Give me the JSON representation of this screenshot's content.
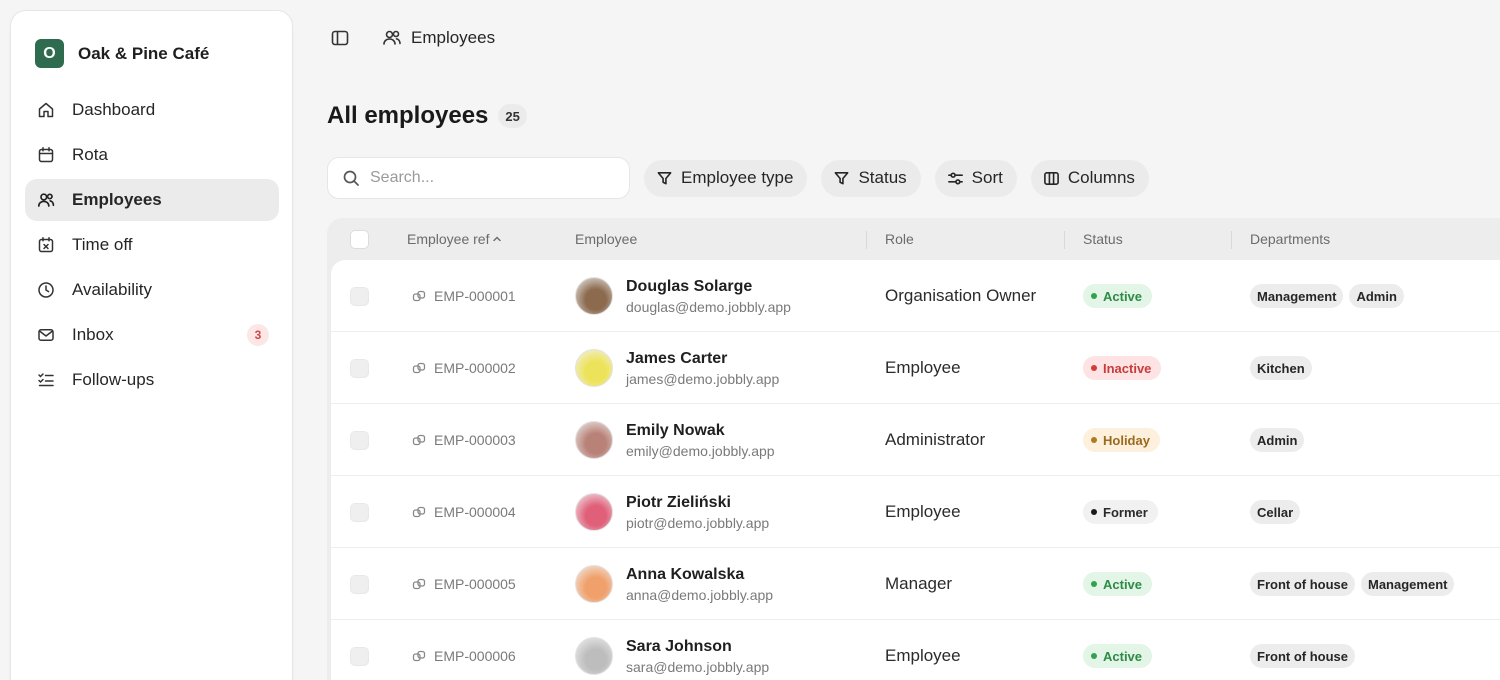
{
  "sidebar": {
    "brand": {
      "initial": "O",
      "name": "Oak & Pine Café"
    },
    "items": [
      {
        "label": "Dashboard",
        "icon": "home-icon"
      },
      {
        "label": "Rota",
        "icon": "calendar-icon"
      },
      {
        "label": "Employees",
        "icon": "users-icon",
        "active": true
      },
      {
        "label": "Time off",
        "icon": "calendar-x-icon"
      },
      {
        "label": "Availability",
        "icon": "clock-icon"
      },
      {
        "label": "Inbox",
        "icon": "mail-icon",
        "badge": "3"
      },
      {
        "label": "Follow-ups",
        "icon": "list-checks-icon"
      }
    ]
  },
  "topbar": {
    "breadcrumb": "Employees"
  },
  "page": {
    "title": "All employees",
    "count": "25"
  },
  "toolbar": {
    "search_placeholder": "Search...",
    "filters": [
      "Employee type",
      "Status",
      "Sort",
      "Columns"
    ]
  },
  "table": {
    "columns": [
      "Employee ref",
      "Employee",
      "Role",
      "Status",
      "Departments"
    ],
    "rows": [
      {
        "ref": "EMP-000001",
        "name": "Douglas Solarge",
        "email": "douglas@demo.jobbly.app",
        "role": "Organisation Owner",
        "status": "Active",
        "departments": [
          "Management",
          "Admin"
        ],
        "avatar_color": "#8b6a4e"
      },
      {
        "ref": "EMP-000002",
        "name": "James Carter",
        "email": "james@demo.jobbly.app",
        "role": "Employee",
        "status": "Inactive",
        "departments": [
          "Kitchen"
        ],
        "avatar_color": "#ede35a"
      },
      {
        "ref": "EMP-000003",
        "name": "Emily Nowak",
        "email": "emily@demo.jobbly.app",
        "role": "Administrator",
        "status": "Holiday",
        "departments": [
          "Admin"
        ],
        "avatar_color": "#b98278"
      },
      {
        "ref": "EMP-000004",
        "name": "Piotr Zieliński",
        "email": "piotr@demo.jobbly.app",
        "role": "Employee",
        "status": "Former",
        "departments": [
          "Cellar"
        ],
        "avatar_color": "#e0607a"
      },
      {
        "ref": "EMP-000005",
        "name": "Anna Kowalska",
        "email": "anna@demo.jobbly.app",
        "role": "Manager",
        "status": "Active",
        "departments": [
          "Front of house",
          "Management"
        ],
        "avatar_color": "#f0a06a"
      },
      {
        "ref": "EMP-000006",
        "name": "Sara Johnson",
        "email": "sara@demo.jobbly.app",
        "role": "Employee",
        "status": "Active",
        "departments": [
          "Front of house"
        ],
        "avatar_color": "#bdbdbd"
      }
    ]
  },
  "status_colors": {
    "Active": {
      "bg": "#e2f5e6",
      "fg": "#2f8a48",
      "dot": "#2fa34f"
    },
    "Inactive": {
      "bg": "#fde3e3",
      "fg": "#c73c3c",
      "dot": "#d43b3b"
    },
    "Holiday": {
      "bg": "#fdf0dc",
      "fg": "#9a6a1e",
      "dot": "#b07a20"
    },
    "Former": {
      "bg": "#f1f1f1",
      "fg": "#2b2b2b",
      "dot": "#1a1a1a"
    }
  }
}
